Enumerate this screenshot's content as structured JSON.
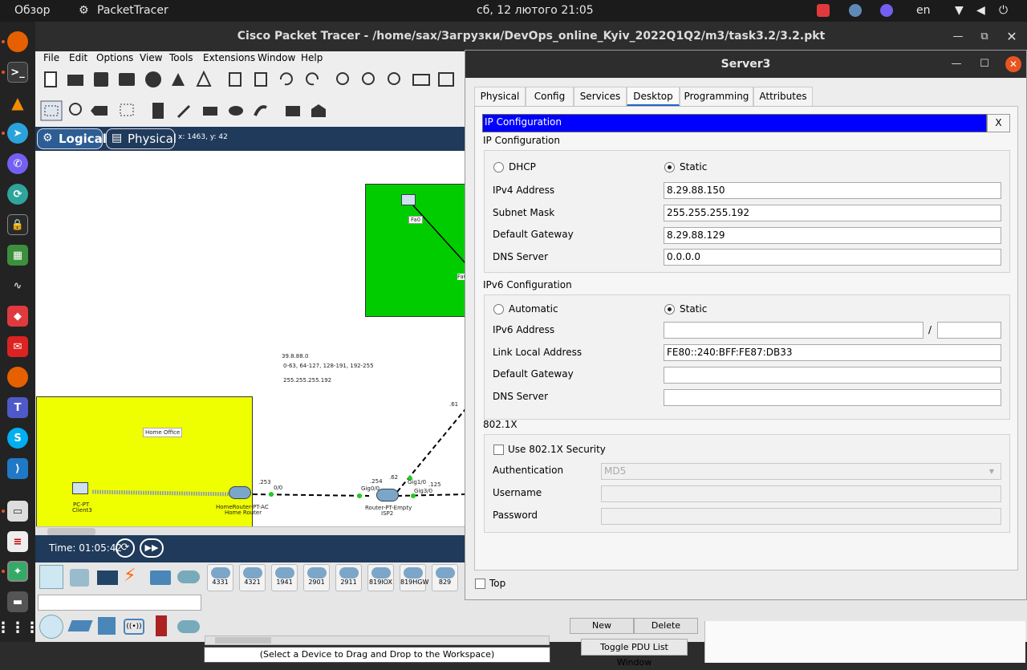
{
  "topbar": {
    "activities": "Обзор",
    "app_name": "PacketTracer",
    "datetime": "сб, 12 лютого  21:05",
    "lang": "en"
  },
  "main_window": {
    "title": "Cisco Packet Tracer - /home/sax/Загрузки/DevOps_online_Kyiv_2022Q1Q2/m3/task3.2/3.2.pkt"
  },
  "menu": {
    "file": "File",
    "edit": "Edit",
    "options": "Options",
    "view": "View",
    "tools": "Tools",
    "extensions": "Extensions",
    "window": "Window",
    "help": "Help"
  },
  "modebar": {
    "logical": "Logical",
    "physical": "Physical",
    "coords": "x: 1463, y: 42"
  },
  "workspace": {
    "net_label": "39.8.88.0",
    "ranges_label": "0-63, 64-127, 128-191, 192-255",
    "mask_label": "255.255.255.192",
    "home_office": "Home Office",
    "client3_type": "PC-PT",
    "client3_name": "Client3",
    "router_type": "HomeRouter-PT-AC",
    "router_name": "Home Router",
    "isp_type": "Router-PT-Empty",
    "isp_name": "ISP2",
    "port_253": ".253",
    "port_00": "0/0",
    "port_254": ".254",
    "port_gig00": "Gig0/0",
    "port_62": ".62",
    "port_gig10": "Gig1/0",
    "port_125": ".125",
    "port_gig30": "Gig3/0",
    "port_61": ".61",
    "port_fa0": "Fa0",
    "top_pc_port": "Fa0"
  },
  "timebar": {
    "time": "Time: 01:05:42"
  },
  "device_models": [
    "4331",
    "4321",
    "1941",
    "2901",
    "2911",
    "819IOX",
    "819HGW",
    "829"
  ],
  "device_hint": "(Select a Device to Drag and Drop to the Workspace)",
  "pdu": {
    "new": "New",
    "delete": "Delete",
    "toggle": "Toggle PDU List Window"
  },
  "server": {
    "title": "Server3",
    "tabs": [
      "Physical",
      "Config",
      "Services",
      "Desktop",
      "Programming",
      "Attributes"
    ],
    "active_tab": "Desktop",
    "panel_header": "IP Configuration",
    "close": "X",
    "ipv4": {
      "section": "IP Configuration",
      "dhcp": "DHCP",
      "static": "Static",
      "mode": "Static",
      "ipv4_label": "IPv4 Address",
      "ipv4_value": "8.29.88.150",
      "mask_label": "Subnet Mask",
      "mask_value": "255.255.255.192",
      "gw_label": "Default Gateway",
      "gw_value": "8.29.88.129",
      "dns_label": "DNS Server",
      "dns_value": "0.0.0.0"
    },
    "ipv6": {
      "section": "IPv6 Configuration",
      "automatic": "Automatic",
      "static": "Static",
      "mode": "Static",
      "addr_label": "IPv6 Address",
      "addr_value": "",
      "slash": "/",
      "prefix_value": "",
      "link_local_label": "Link Local Address",
      "link_local_value": "FE80::240:BFF:FE87:DB33",
      "gw_label": "Default Gateway",
      "gw_value": "",
      "dns_label": "DNS Server",
      "dns_value": ""
    },
    "dot1x": {
      "section": "802.1X",
      "use_label": "Use 802.1X Security",
      "auth_label": "Authentication",
      "auth_value": "MD5",
      "user_label": "Username",
      "pass_label": "Password"
    },
    "top_label": "Top"
  }
}
